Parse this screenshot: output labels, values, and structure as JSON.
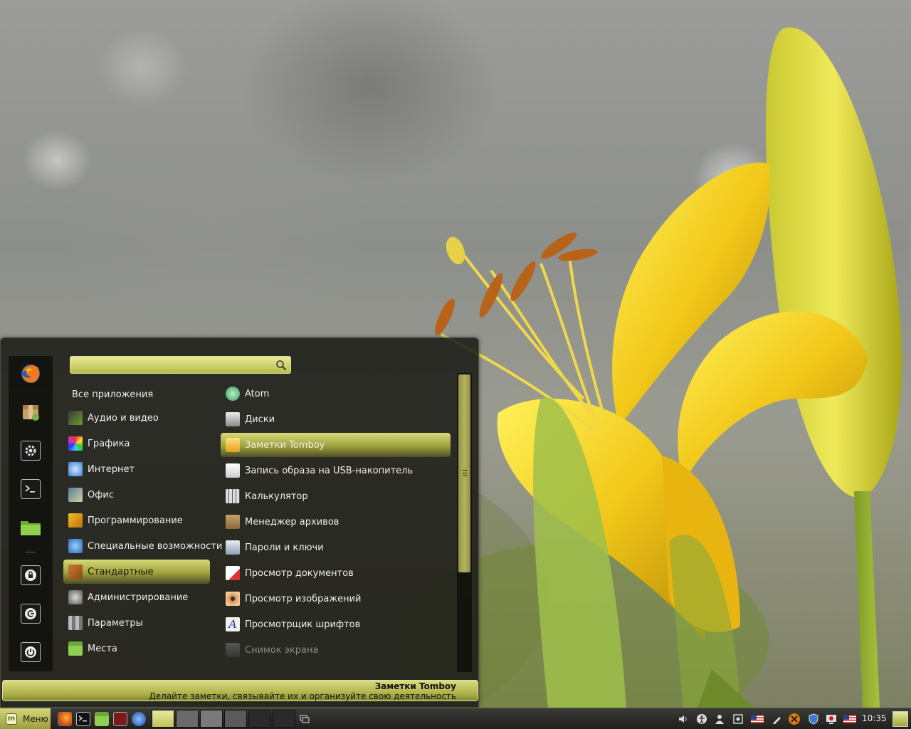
{
  "menu": {
    "search": {
      "value": "",
      "placeholder": ""
    },
    "categories": [
      {
        "label": "Все приложения",
        "icon": "none"
      },
      {
        "label": "Аудио и видео",
        "icon": "audio-video-icon"
      },
      {
        "label": "Графика",
        "icon": "graphics-icon"
      },
      {
        "label": "Интернет",
        "icon": "internet-icon"
      },
      {
        "label": "Офис",
        "icon": "office-icon"
      },
      {
        "label": "Программирование",
        "icon": "programming-icon"
      },
      {
        "label": "Специальные возможности",
        "icon": "accessibility-icon"
      },
      {
        "label": "Стандартные",
        "icon": "accessories-icon",
        "selected": true
      },
      {
        "label": "Администрирование",
        "icon": "administration-icon"
      },
      {
        "label": "Параметры",
        "icon": "preferences-icon"
      },
      {
        "label": "Места",
        "icon": "places-folder-icon"
      }
    ],
    "apps": [
      {
        "label": "Atom",
        "icon": "atom-icon"
      },
      {
        "label": "Диски",
        "icon": "disks-icon"
      },
      {
        "label": "Заметки Tomboy",
        "icon": "tomboy-notes-icon",
        "selected": true
      },
      {
        "label": "Запись образа на USB-накопитель",
        "icon": "usb-image-writer-icon"
      },
      {
        "label": "Калькулятор",
        "icon": "calculator-icon"
      },
      {
        "label": "Менеджер архивов",
        "icon": "archive-manager-icon"
      },
      {
        "label": "Пароли и ключи",
        "icon": "passwords-keys-icon"
      },
      {
        "label": "Просмотр документов",
        "icon": "document-viewer-icon"
      },
      {
        "label": "Просмотр изображений",
        "icon": "image-viewer-icon"
      },
      {
        "label": "Просмотрщик шрифтов",
        "icon": "font-viewer-icon"
      },
      {
        "label": "Снимок экрана",
        "icon": "screenshot-icon",
        "dimmed": true
      }
    ],
    "description": {
      "title": "Заметки Tomboy",
      "text": "Делайте заметки, связывайте их и организуйте свою деятельность"
    },
    "favorites": [
      "firefox-icon",
      "software-manager-icon",
      "system-settings-icon",
      "terminal-icon",
      "files-folder-icon",
      "lock-screen-icon",
      "logout-icon",
      "shutdown-icon"
    ]
  },
  "taskbar": {
    "menu_label": "Меню",
    "clock": "10:35",
    "launchers": [
      "firefox-icon",
      "terminal-icon",
      "files-folder-icon",
      "mail-icon",
      "browser-globe-icon"
    ],
    "tray": [
      "volume-icon",
      "accessibility-icon",
      "user-icon",
      "notes-icon",
      "us-flag-icon",
      "pencil-icon",
      "update-warning-icon",
      "shield-icon",
      "network-icon",
      "us-flag-icon"
    ]
  },
  "colors": {
    "accent": "#c8cc5c",
    "accent_dark": "#9fa13c",
    "menu_bg": "#1c1c18"
  }
}
